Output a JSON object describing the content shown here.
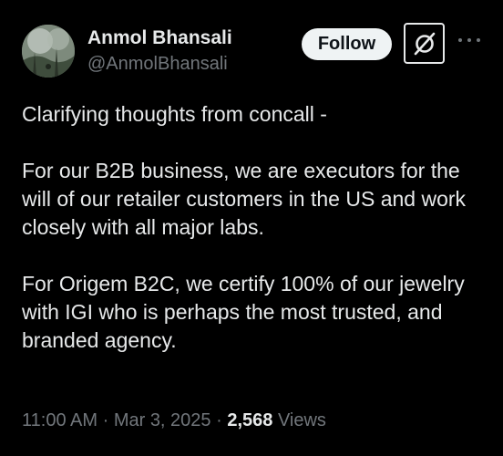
{
  "author": {
    "display_name": "Anmol Bhansali",
    "handle": "@AnmolBhansali"
  },
  "actions": {
    "follow_label": "Follow",
    "grok_icon": "grok-icon",
    "more_icon": "more-options-icon"
  },
  "tweet": {
    "paragraphs": [
      "Clarifying thoughts from concall -",
      "For our B2B business, we are executors for the will of our retailer customers in the US and work closely with all major labs.",
      "For Origem B2C, we certify 100% of our jewelry with IGI who is perhaps the most trusted, and branded agency."
    ]
  },
  "meta": {
    "time": "11:00 AM",
    "separator": " · ",
    "date": "Mar 3, 2025",
    "views_count": "2,568",
    "views_label": " Views"
  },
  "colors": {
    "background": "#000000",
    "primary_text": "#e7e9ea",
    "secondary_text": "#71767b",
    "follow_bg": "#eff3f4"
  }
}
